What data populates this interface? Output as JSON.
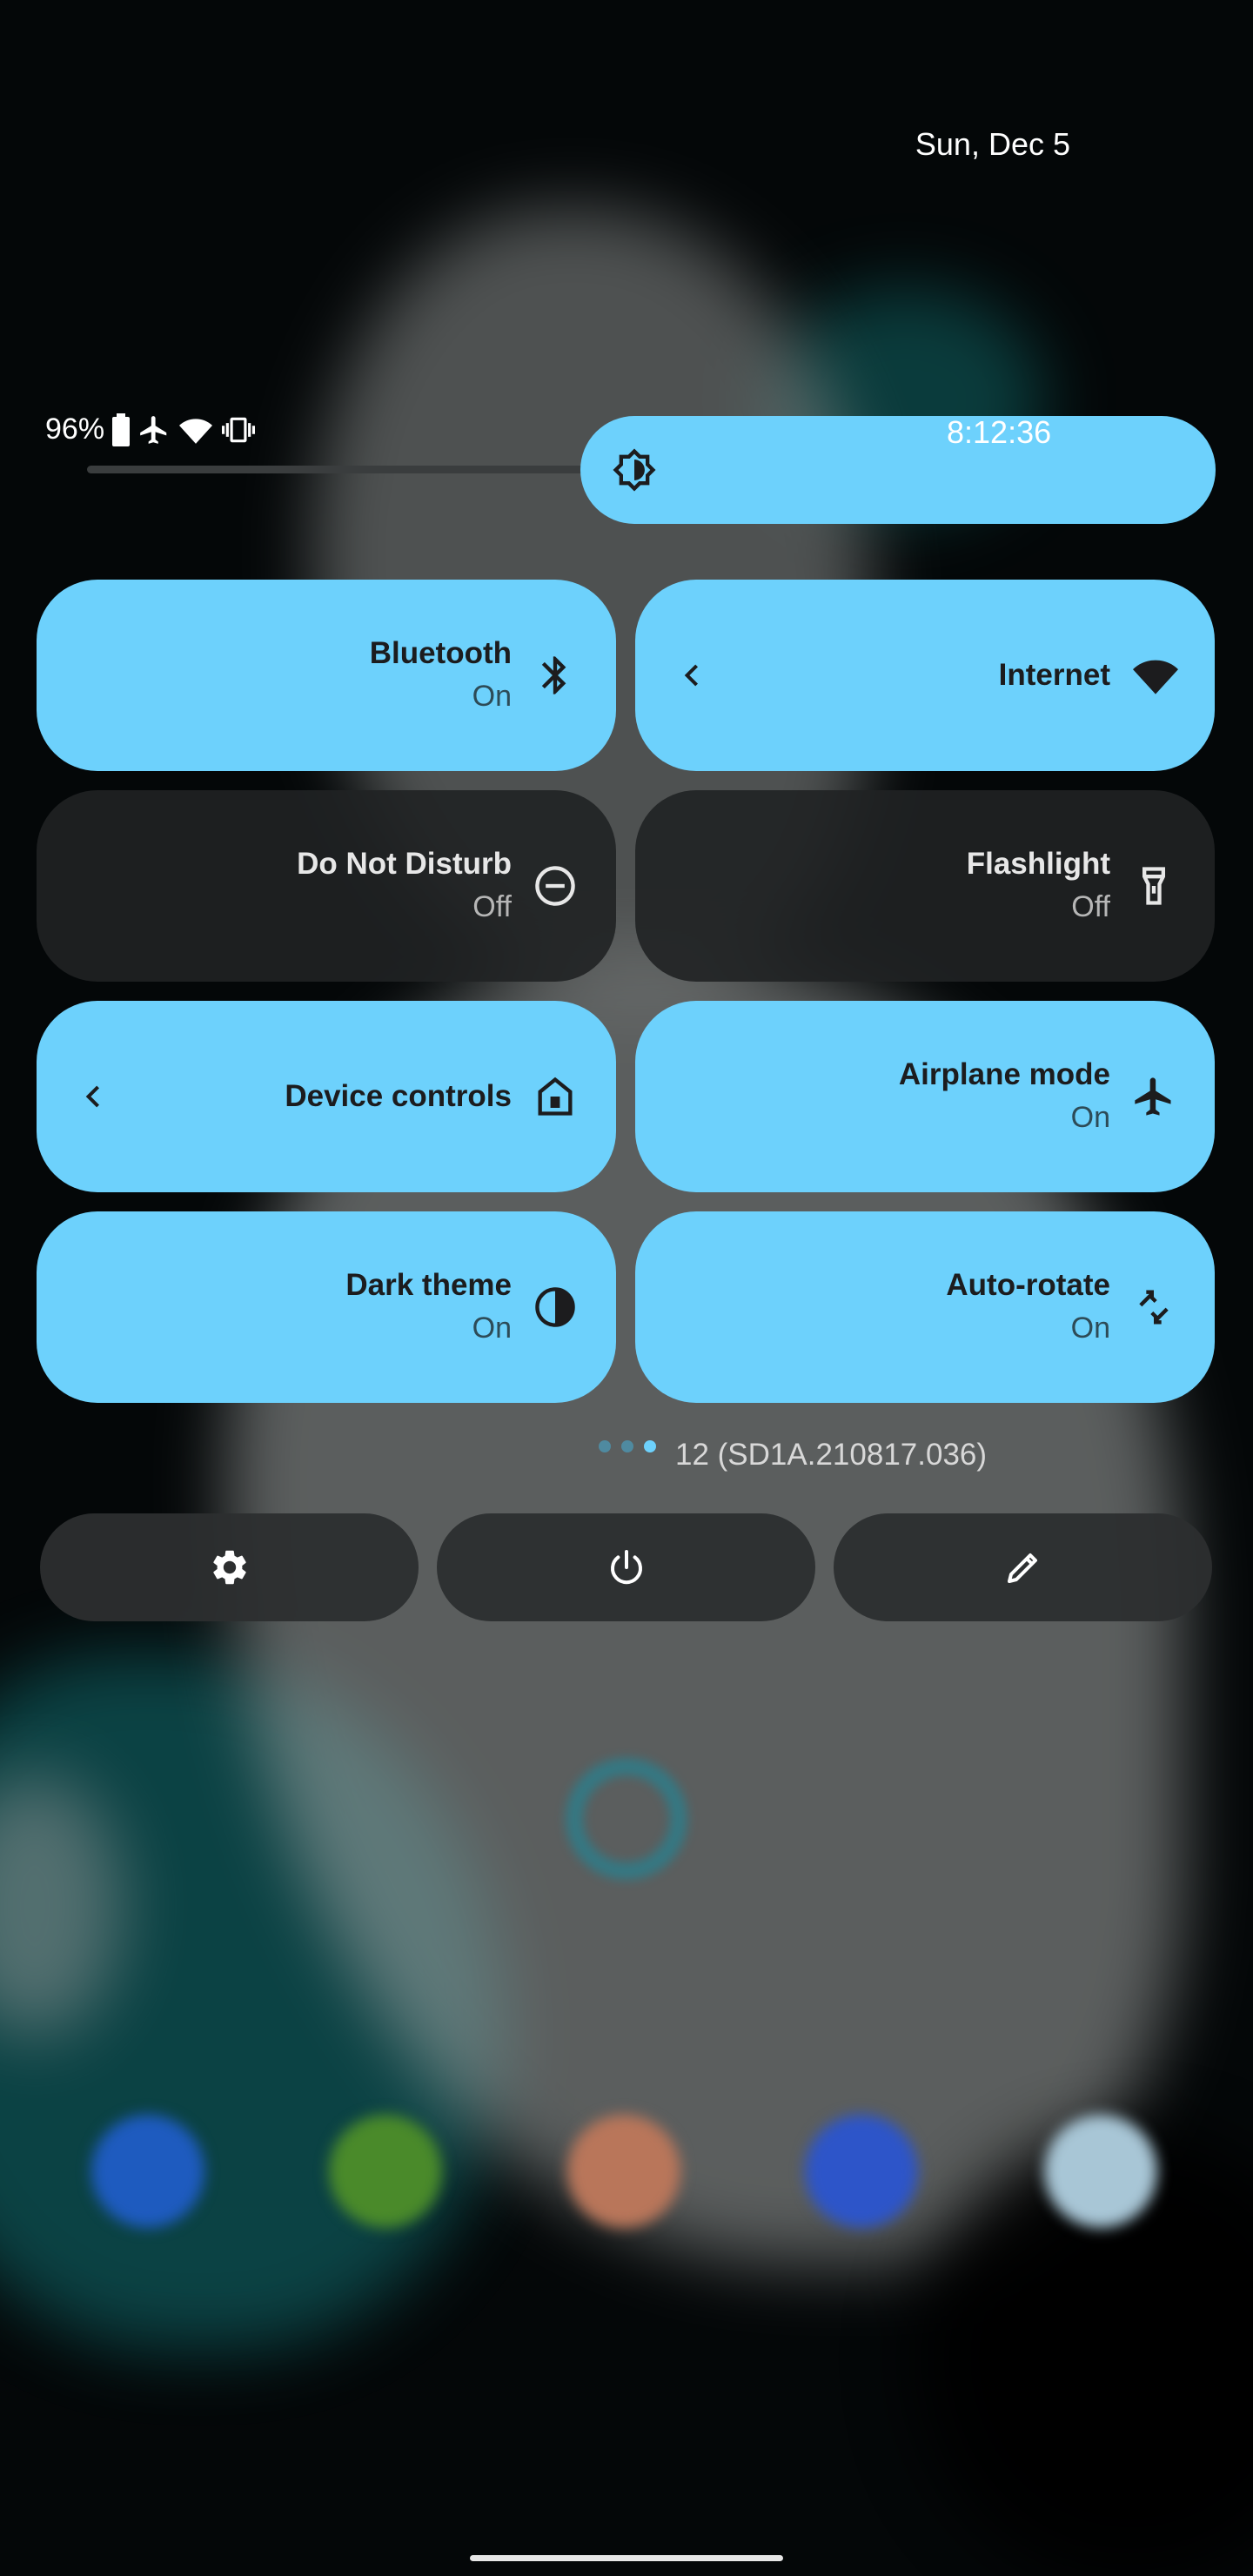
{
  "header": {
    "date": "Sun, Dec 5",
    "clock": "8:12:36",
    "battery_text": "96%"
  },
  "status_icons": [
    "battery-icon",
    "airplane-icon",
    "wifi-icon",
    "vibrate-icon"
  ],
  "brightness": {
    "icon": "brightness-icon",
    "level": 0.45
  },
  "tiles": [
    {
      "label": "Bluetooth",
      "sub": "On",
      "icon": "bluetooth-icon",
      "state": "on"
    },
    {
      "label": "Internet",
      "sub": "",
      "icon": "wifi-icon",
      "state": "on",
      "chevron": true
    },
    {
      "label": "Do Not Disturb",
      "sub": "Off",
      "icon": "dnd-icon",
      "state": "off"
    },
    {
      "label": "Flashlight",
      "sub": "Off",
      "icon": "flashlight-icon",
      "state": "off"
    },
    {
      "label": "Device controls",
      "sub": "",
      "icon": "home-icon",
      "state": "on",
      "chevron": true
    },
    {
      "label": "Airplane mode",
      "sub": "On",
      "icon": "airplane-icon",
      "state": "on"
    },
    {
      "label": "Dark theme",
      "sub": "On",
      "icon": "dark-theme-icon",
      "state": "on"
    },
    {
      "label": "Auto-rotate",
      "sub": "On",
      "icon": "rotate-icon",
      "state": "on"
    }
  ],
  "pager": {
    "pages": 3,
    "active": 2
  },
  "build_number": "12 (SD1A.210817.036)",
  "bottom_buttons": [
    {
      "name": "settings-button",
      "icon": "gear-icon"
    },
    {
      "name": "power-button",
      "icon": "power-icon"
    },
    {
      "name": "edit-button",
      "icon": "pencil-icon"
    }
  ],
  "colors": {
    "accent": "#6dd1fc",
    "tile_off": "#202223",
    "background": "#040708"
  }
}
